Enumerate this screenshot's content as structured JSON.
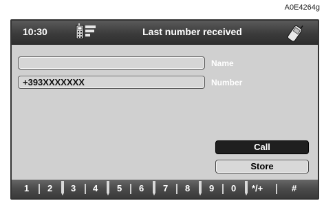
{
  "figure_code": "A0E4264g",
  "header": {
    "time": "10:30",
    "title": "Last number received",
    "left_icon": "phonebook-icon",
    "right_icon": "mobile-phone-icon"
  },
  "form": {
    "name_value": "",
    "name_label": "Name",
    "number_value": "+393XXXXXXX",
    "number_label": "Number"
  },
  "buttons": {
    "call": "Call",
    "store": "Store"
  },
  "keypad": [
    "1",
    "2",
    "3",
    "4",
    "5",
    "6",
    "7",
    "8",
    "9",
    "0",
    "*/+",
    "#"
  ]
}
